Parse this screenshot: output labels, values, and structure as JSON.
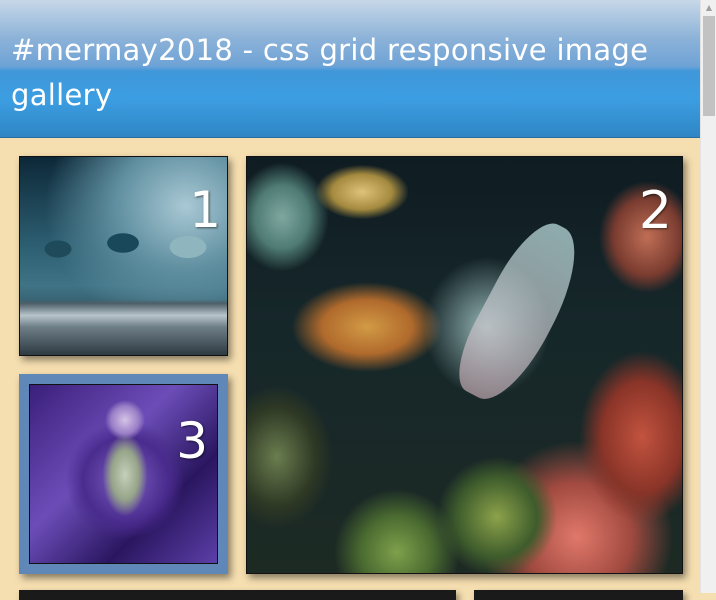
{
  "header": {
    "title": "#mermay2018 - css grid responsive image gallery"
  },
  "gallery": {
    "items": [
      {
        "number": "1",
        "image": "horses-in-surf-image"
      },
      {
        "number": "2",
        "image": "coral-reef-mermaid-image"
      },
      {
        "number": "3",
        "image": "purple-fractal-mermaid-image"
      },
      {
        "number": "",
        "image": "gallery-image"
      },
      {
        "number": "",
        "image": "gallery-image"
      }
    ]
  },
  "colors": {
    "page_background": "#f5deb0",
    "header_gradient_top": "#c7d8e8",
    "header_gradient_bottom": "#2f86c4",
    "frame_blue": "#5f87b8"
  }
}
